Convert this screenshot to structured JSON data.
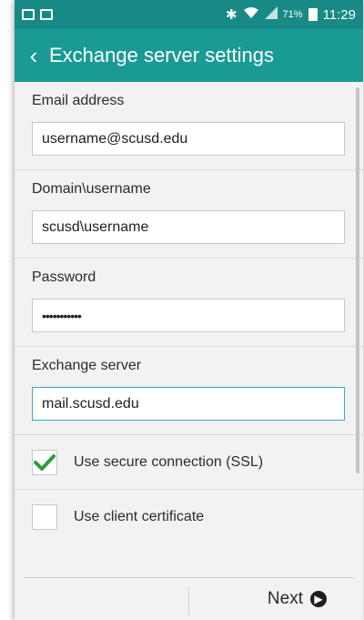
{
  "status_bar": {
    "left_icons": [
      "gallery-icon",
      "picture-icon"
    ],
    "right_icons": [
      "bluetooth-icon",
      "wifi-icon",
      "signal-icon",
      "battery-icon"
    ],
    "battery": "71%",
    "time": "11:29"
  },
  "app_bar": {
    "title": "Exchange server settings",
    "back_icon": "chevron-left-icon"
  },
  "fields": {
    "email": {
      "label": "Email address",
      "value": "username@scusd.edu"
    },
    "domain_user": {
      "label": "Domain\\username",
      "value": "scusd\\username"
    },
    "password": {
      "label": "Password",
      "value": "•••••••••••"
    },
    "server": {
      "label": "Exchange server",
      "value": "mail.scusd.edu"
    }
  },
  "options": {
    "ssl": {
      "label": "Use secure connection (SSL)",
      "checked": true
    },
    "client_cert": {
      "label": "Use client certificate",
      "checked": false
    }
  },
  "bottom_bar": {
    "next_label": "Next"
  },
  "colors": {
    "status_bar": "#178a85",
    "app_bar": "#1a9a94",
    "check": "#2e9e3e",
    "focus_border": "#3fa3c8"
  }
}
